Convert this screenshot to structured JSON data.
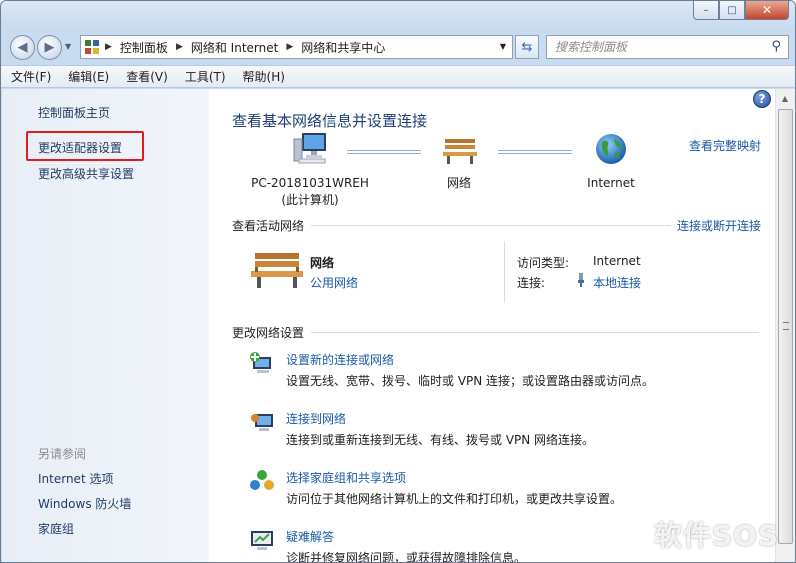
{
  "caption": {
    "minimize": "–",
    "maximize": "□",
    "close": "✕"
  },
  "address": {
    "crumbs": [
      "控制面板",
      "网络和 Internet",
      "网络和共享中心"
    ],
    "search_placeholder": "搜索控制面板"
  },
  "menu": [
    "文件(F)",
    "编辑(E)",
    "查看(V)",
    "工具(T)",
    "帮助(H)"
  ],
  "sidebar": {
    "items": [
      "控制面板主页",
      "更改适配器设置",
      "更改高级共享设置"
    ],
    "see_also_title": "另请参阅",
    "see_also": [
      "Internet 选项",
      "Windows 防火墙",
      "家庭组"
    ]
  },
  "main": {
    "help": "?",
    "title": "查看基本网络信息并设置连接",
    "full_map": "查看完整映射",
    "nodes": {
      "computer_name": "PC-20181031WREH",
      "computer_sub": "(此计算机)",
      "network": "网络",
      "internet": "Internet"
    },
    "active_heading": "查看活动网络",
    "connect_disconnect": "连接或断开连接",
    "active": {
      "name": "网络",
      "type": "公用网络",
      "access_label": "访问类型:",
      "access_value": "Internet",
      "conn_label": "连接:",
      "conn_value": "本地连接"
    },
    "change_heading": "更改网络设置",
    "tasks": [
      {
        "title": "设置新的连接或网络",
        "desc": "设置无线、宽带、拨号、临时或 VPN 连接；或设置路由器或访问点。"
      },
      {
        "title": "连接到网络",
        "desc": "连接到或重新连接到无线、有线、拨号或 VPN 网络连接。"
      },
      {
        "title": "选择家庭组和共享选项",
        "desc": "访问位于其他网络计算机上的文件和打印机，或更改共享设置。"
      },
      {
        "title": "疑难解答",
        "desc": "诊断并修复网络问题，或获得故障排除信息。"
      }
    ]
  },
  "watermark": "软件SOS",
  "colors": {
    "link": "#1a5aa6",
    "title": "#1e3f75",
    "highlight": "#e31b1b"
  }
}
